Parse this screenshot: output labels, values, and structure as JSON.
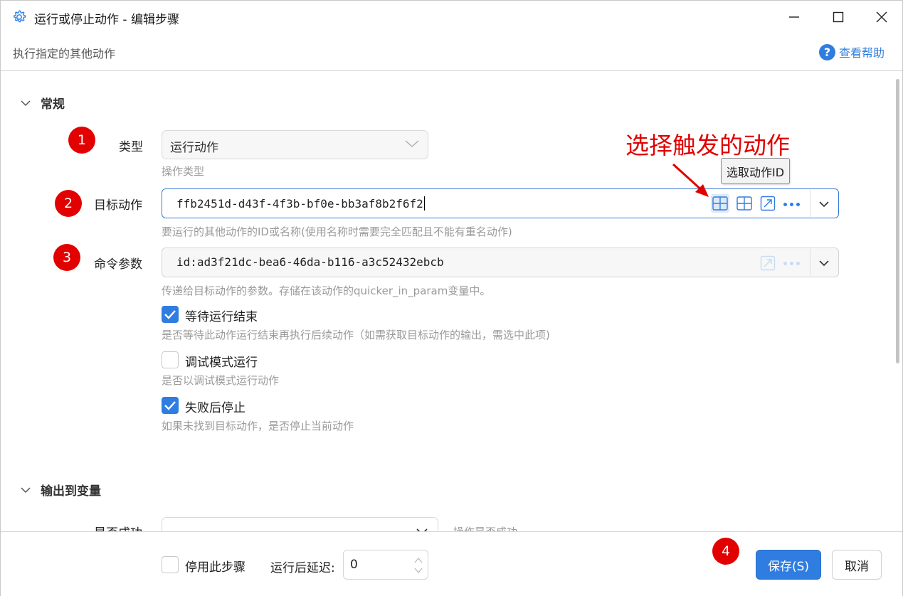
{
  "window": {
    "title": "运行或停止动作  -  编辑步骤",
    "subtitle": "执行指定的其他动作",
    "help_label": "查看帮助",
    "help_icon": "question-circle-icon"
  },
  "annotation": {
    "text": "选择触发的动作",
    "tooltip": "选取动作ID",
    "color": "#e00000"
  },
  "badges": [
    "1",
    "2",
    "3",
    "4"
  ],
  "general": {
    "heading": "常规",
    "type": {
      "label": "类型",
      "value": "运行动作",
      "hint": "操作类型"
    },
    "target": {
      "label": "目标动作",
      "value": "ffb2451d-d43f-4f3b-bf0e-bb3af8b2f6f2",
      "hint": "要运行的其他动作的ID或名称(使用名称时需要完全匹配且不能有重名动作)"
    },
    "params": {
      "label": "命令参数",
      "value": "id:ad3f21dc-bea6-46da-b116-a3c52432ebcb",
      "hint": "传递给目标动作的参数。存储在该动作的quicker_in_param变量中。"
    },
    "checks": [
      {
        "label": "等待运行结束",
        "checked": true,
        "hint": "是否等待此动作运行结束再执行后续动作（如需获取目标动作的输出，需选中此项)"
      },
      {
        "label": "调试模式运行",
        "checked": false,
        "hint": "是否以调试模式运行动作"
      },
      {
        "label": "失败后停止",
        "checked": true,
        "hint": "如果未找到目标动作，是否停止当前动作"
      }
    ]
  },
  "output": {
    "heading": "输出到变量",
    "success_label": "是否成功",
    "success_value": "",
    "success_hint": "操作是否成功"
  },
  "footer": {
    "disable_label": "停用此步骤",
    "disable_checked": false,
    "delay_label": "运行后延迟:",
    "delay_value": "0",
    "save_label": "保存(S)",
    "cancel_label": "取消"
  },
  "colors": {
    "accent": "#2f7de1",
    "badge": "#e30000",
    "hint_text": "#9a9a9a"
  }
}
